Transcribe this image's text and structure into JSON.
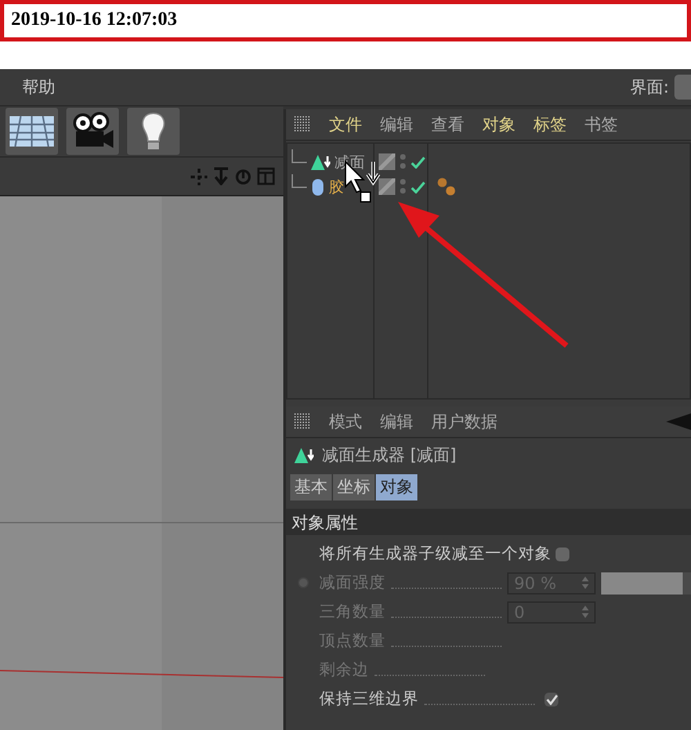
{
  "timestamp": "2019-10-16 12:07:03",
  "menu_bar": {
    "items": [
      "帮助"
    ],
    "layout_label": "界面:"
  },
  "object_manager": {
    "menu": [
      {
        "label": "文件",
        "active": true
      },
      {
        "label": "编辑",
        "active": false
      },
      {
        "label": "查看",
        "active": false
      },
      {
        "label": "对象",
        "active": true
      },
      {
        "label": "标签",
        "active": true
      },
      {
        "label": "书签",
        "active": false
      }
    ],
    "objects": [
      {
        "name": "减面",
        "kind": "reduction",
        "selected": false,
        "checked": true,
        "has_material": false
      },
      {
        "name": "胶",
        "kind": "capsule",
        "selected": true,
        "checked": true,
        "has_material": true
      }
    ]
  },
  "attribute_manager": {
    "menu": [
      "模式",
      "编辑",
      "用户数据"
    ],
    "title": "减面生成器 [减面]",
    "tabs": [
      {
        "label": "基本",
        "selected": false
      },
      {
        "label": "坐标",
        "selected": false
      },
      {
        "label": "对象",
        "selected": true
      }
    ],
    "section": "对象属性",
    "rows": [
      {
        "kind": "checkbox",
        "label": "将所有生成器子级减至一个对象",
        "checked": false,
        "disabled": false
      },
      {
        "kind": "slider",
        "label": "减面强度",
        "value": "90 %",
        "level": 0.9,
        "disabled": true
      },
      {
        "kind": "number",
        "label": "三角数量",
        "value": "0",
        "disabled": true
      },
      {
        "kind": "plain",
        "label": "顶点数量",
        "disabled": true
      },
      {
        "kind": "plain",
        "label": "剩余边",
        "disabled": true
      },
      {
        "kind": "checkbox",
        "label": "保持三维边界",
        "checked": true,
        "disabled": false
      }
    ]
  }
}
